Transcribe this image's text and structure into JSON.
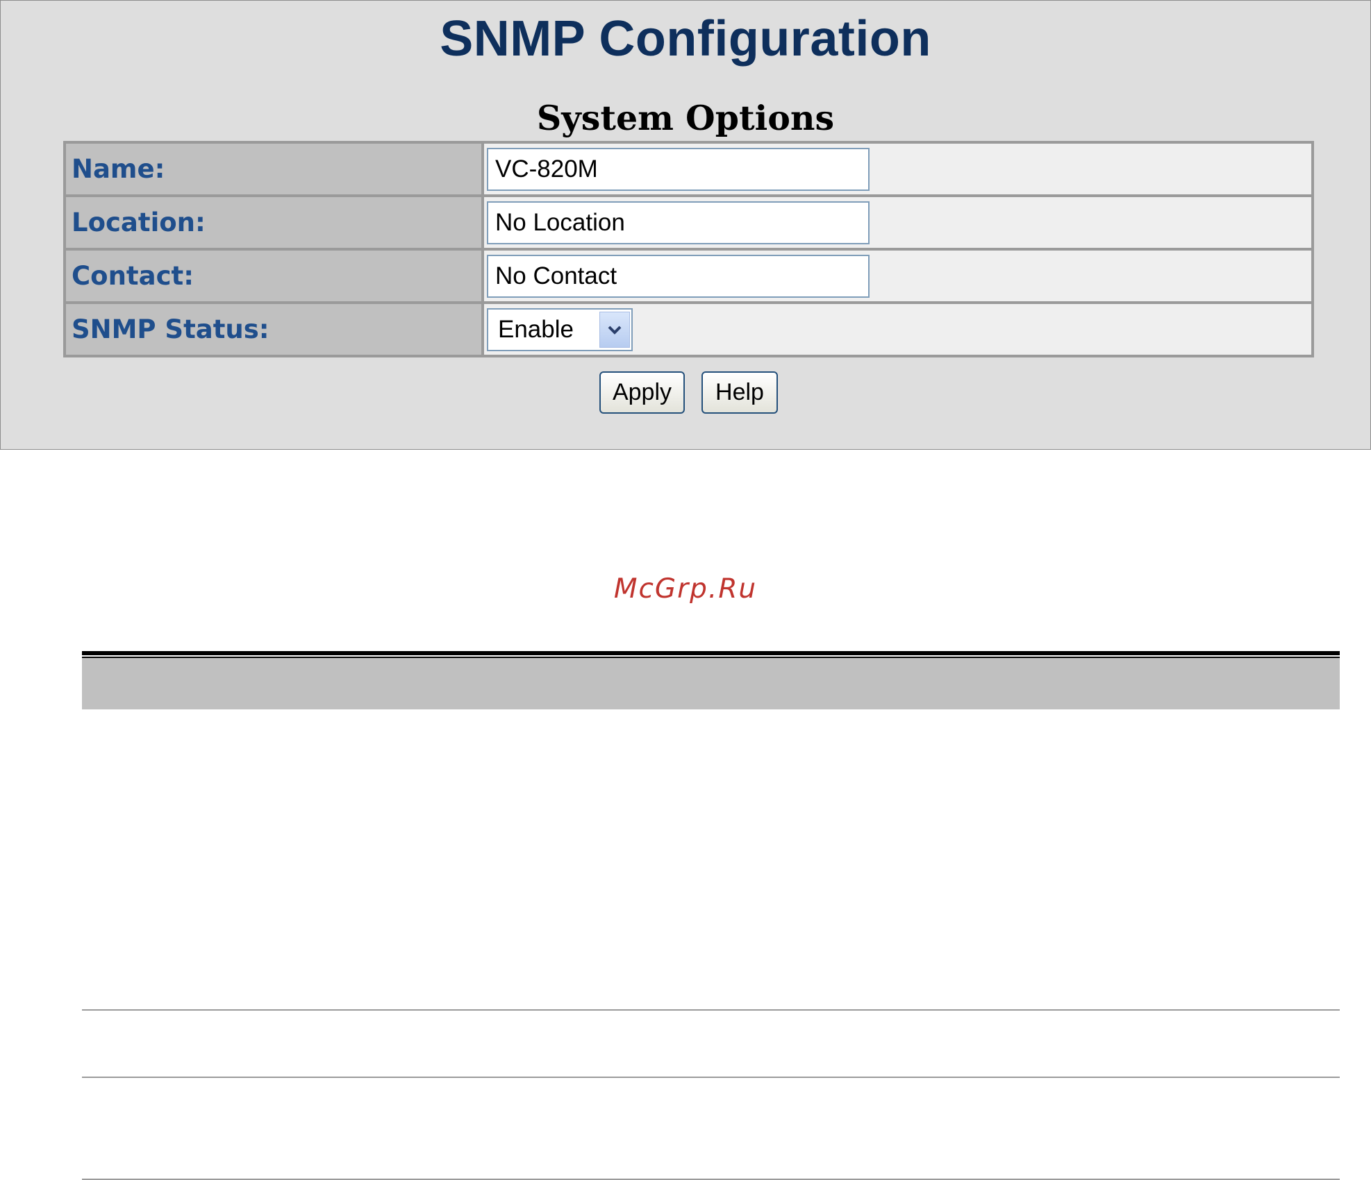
{
  "page": {
    "title": "SNMP Configuration",
    "section_title": "System Options"
  },
  "fields": [
    {
      "label": "Name:",
      "value": "VC-820M"
    },
    {
      "label": "Location:",
      "value": "No Location"
    },
    {
      "label": "Contact:",
      "value": "No Contact"
    }
  ],
  "snmp_status": {
    "label": "SNMP Status:",
    "selected": "Enable"
  },
  "buttons": {
    "apply": "Apply",
    "help": "Help"
  },
  "watermark": "McGrp.Ru",
  "icons": {
    "dropdown": "chevron-down-icon"
  }
}
